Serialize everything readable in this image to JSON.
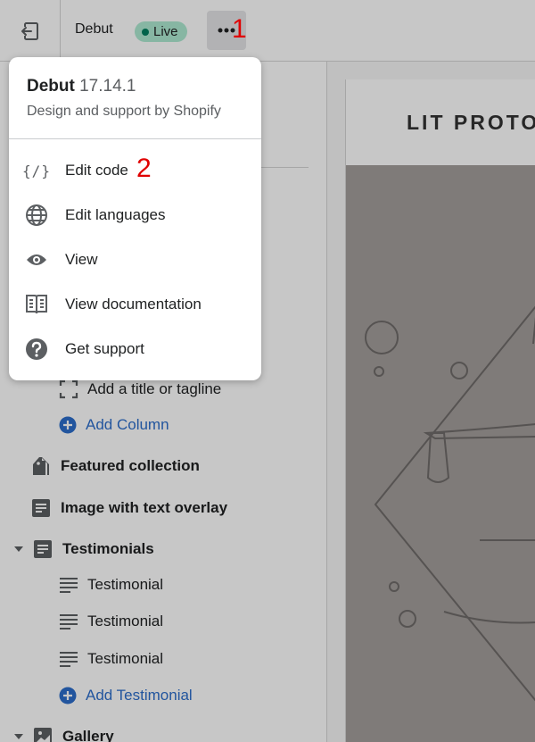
{
  "topbar": {
    "theme_name": "Debut",
    "live_badge": "Live",
    "more_label": "•••"
  },
  "annotations": {
    "marker_1": "1",
    "marker_2": "2"
  },
  "popover": {
    "theme": "Debut",
    "version": "17.14.1",
    "subtitle": "Design and support by Shopify",
    "items": [
      {
        "label": "Edit code",
        "icon": "code-icon"
      },
      {
        "label": "Edit languages",
        "icon": "globe-icon"
      },
      {
        "label": "View",
        "icon": "eye-icon"
      },
      {
        "label": "View documentation",
        "icon": "book-icon"
      },
      {
        "label": "Get support",
        "icon": "help-icon"
      }
    ]
  },
  "sidebar": {
    "items": [
      {
        "label": "Add a title or tagline",
        "icon": "title-placeholder-icon"
      },
      {
        "label": "Add Column",
        "icon": "plus-circle-icon"
      },
      {
        "label": "Featured collection",
        "icon": "tag-icon"
      },
      {
        "label": "Image with text overlay",
        "icon": "text-block-icon"
      },
      {
        "label": "Testimonials",
        "icon": "text-block-icon"
      },
      {
        "label": "Testimonial",
        "icon": "lines-icon"
      },
      {
        "label": "Testimonial",
        "icon": "lines-icon"
      },
      {
        "label": "Testimonial",
        "icon": "lines-icon"
      },
      {
        "label": "Add Testimonial",
        "icon": "plus-circle-icon"
      },
      {
        "label": "Gallery",
        "icon": "image-icon"
      }
    ]
  },
  "preview": {
    "store_title": "LIT PROTO"
  },
  "colors": {
    "live_badge_bg": "#aee9d1",
    "link_blue": "#2c6ecb",
    "annotation_red": "#e00000"
  }
}
